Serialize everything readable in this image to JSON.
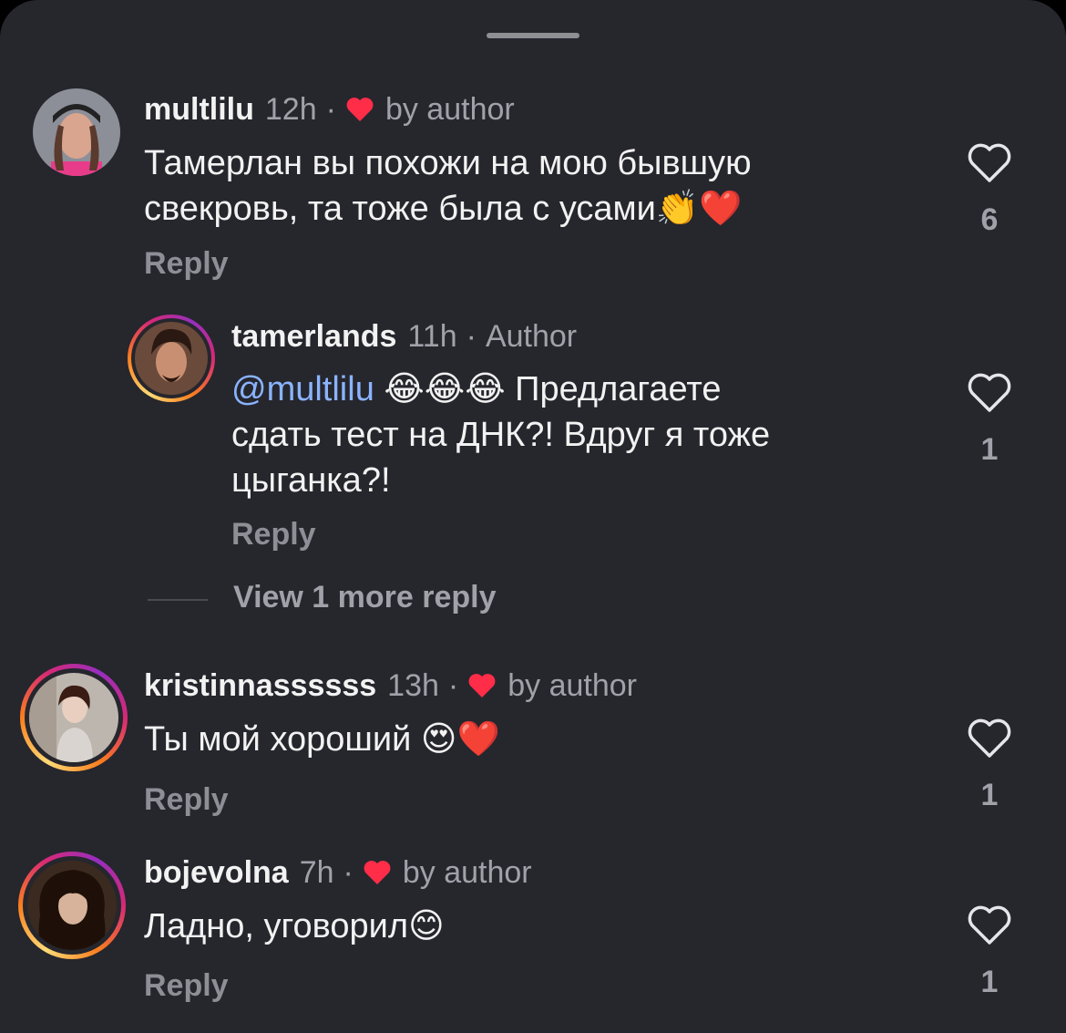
{
  "comments": [
    {
      "username": "multlilu",
      "time": "12h",
      "dot": "·",
      "badge": "by author",
      "text_line1": "Тамерлан вы похожи на мою бывшую",
      "text_line2": "свекровь, та тоже была с усами👏❤️",
      "reply_label": "Reply",
      "likes": "6"
    },
    {
      "username": "tamerlands",
      "time": "11h",
      "dot": "·",
      "badge": "Author",
      "mention": "@multlilu",
      "text_line1_rest": " 😂😂😂 Предлагаете",
      "text_line2": "сдать тест на ДНК?! Вдруг я тоже",
      "text_line3": "цыганка?!",
      "reply_label": "Reply",
      "likes": "1"
    },
    {
      "username": "kristinnassssss",
      "time": "13h",
      "dot": "·",
      "badge": "by author",
      "text_line1": "Ты мой хороший 😍❤️",
      "reply_label": "Reply",
      "likes": "1"
    },
    {
      "username": "bojevolna",
      "time": "7h",
      "dot": "·",
      "badge": "by author",
      "text_line1": "Ладно, уговорил😊",
      "reply_label": "Reply",
      "likes": "1"
    }
  ],
  "view_more_label": "View 1 more reply",
  "colors": {
    "heart_red": "#ff2d48",
    "mention_blue": "#8ab4ff",
    "background": "#26262d"
  }
}
